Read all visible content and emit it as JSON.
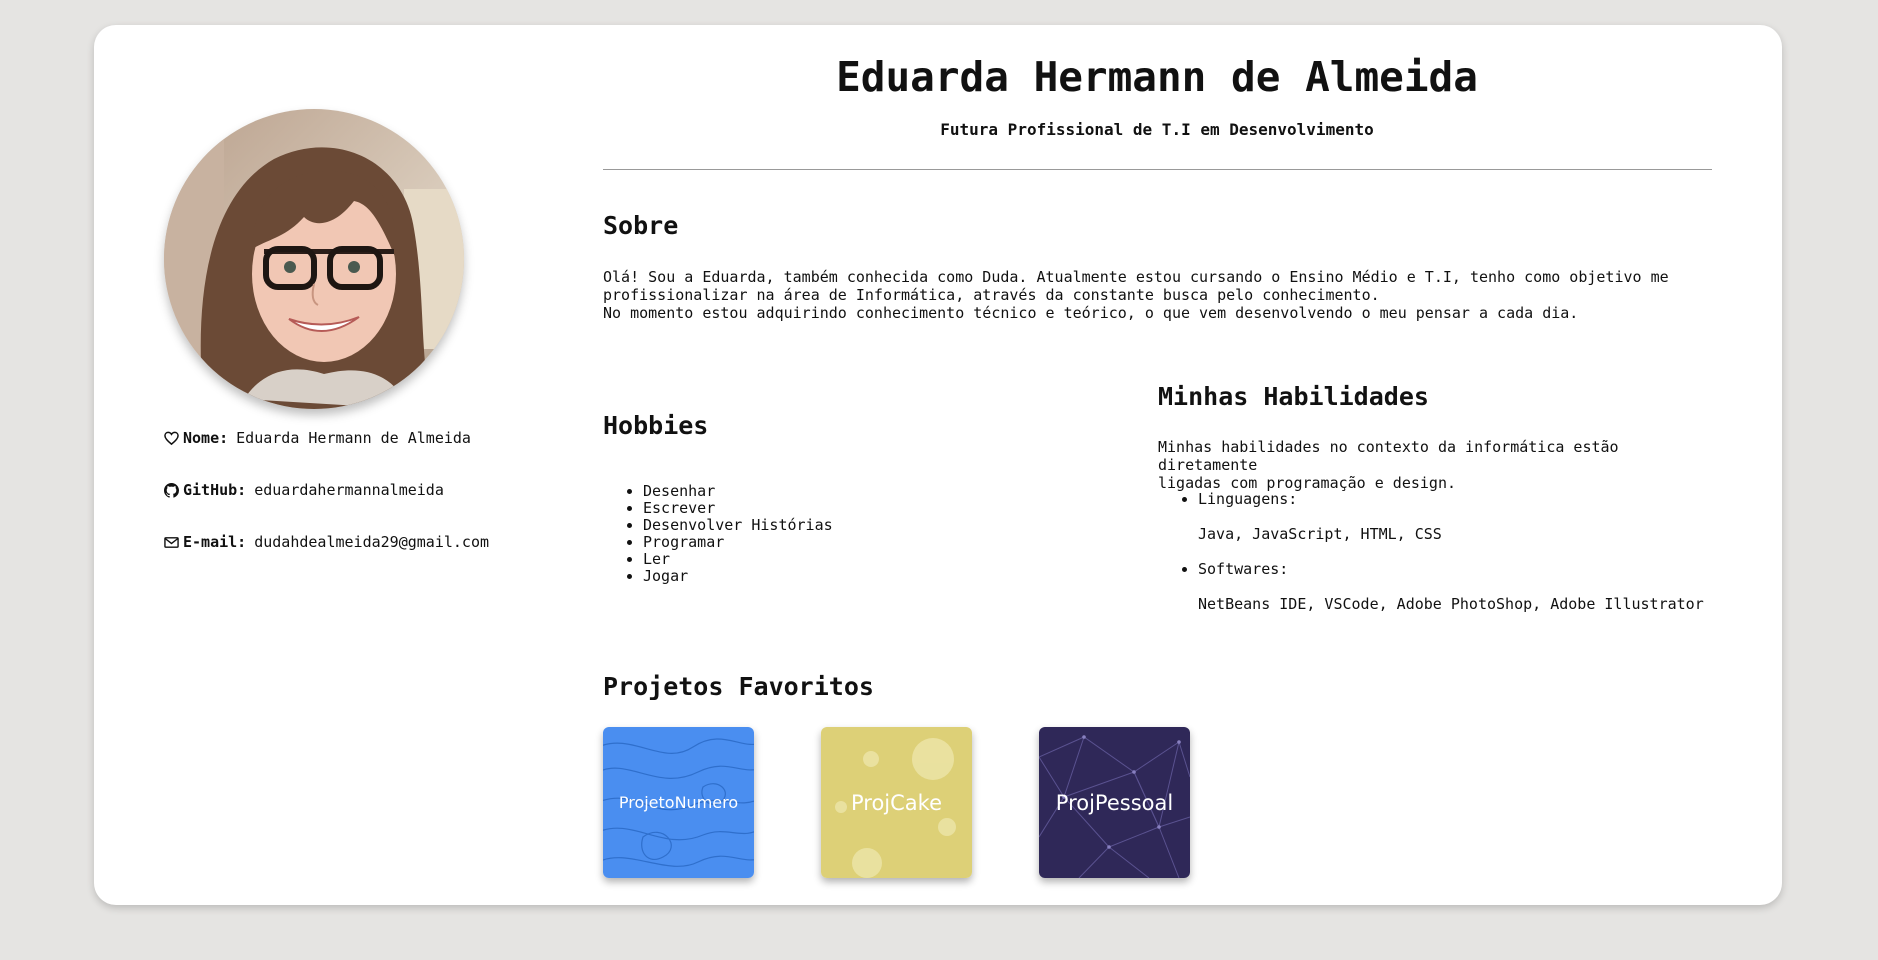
{
  "profile": {
    "name": "Eduarda Hermann de Almeida",
    "subtitle": "Futura Profissional de T.I em Desenvolvimento",
    "info": [
      {
        "icon": "heart-icon",
        "label": "Nome:",
        "value": "Eduarda Hermann de Almeida"
      },
      {
        "icon": "github-icon",
        "label": "GitHub:",
        "value": "eduardahermannalmeida"
      },
      {
        "icon": "mail-icon",
        "label": "E-mail:",
        "value": "dudahdealmeida29@gmail.com"
      }
    ]
  },
  "sobre": {
    "title": "Sobre",
    "line1": "Olá! Sou a Eduarda, também conhecida como Duda. Atualmente estou cursando o Ensino Médio e T.I, tenho como objetivo me",
    "line2": "profissionalizar na área de Informática, através da constante busca pelo conhecimento.",
    "line3": "No momento estou adquirindo conhecimento técnico e teórico, o que vem desenvolvendo o meu pensar a cada dia."
  },
  "hobbies": {
    "title": "Hobbies",
    "items": [
      "Desenhar",
      "Escrever",
      "Desenvolver Histórias",
      "Programar",
      "Ler",
      "Jogar"
    ]
  },
  "habilidades": {
    "title": "Minhas Habilidades",
    "intro_line1": "Minhas habilidades no contexto da informática estão diretamente",
    "intro_line2": "ligadas com programação e design.",
    "items": [
      {
        "label": "Linguagens:",
        "value": "Java, JavaScript, HTML, CSS"
      },
      {
        "label": "Softwares:",
        "value": "NetBeans IDE, VSCode, Adobe PhotoShop, Adobe Illustrator"
      }
    ]
  },
  "projetos": {
    "title": "Projetos Favoritos",
    "items": [
      {
        "label": "ProjetoNumero",
        "color": "#4a8ef0"
      },
      {
        "label": "ProjCake",
        "color": "#ddd077"
      },
      {
        "label": "ProjPessoal",
        "color": "#2f2858"
      }
    ]
  },
  "colors": {
    "page_bg": "#e5e4e2",
    "card_bg": "#ffffff"
  }
}
